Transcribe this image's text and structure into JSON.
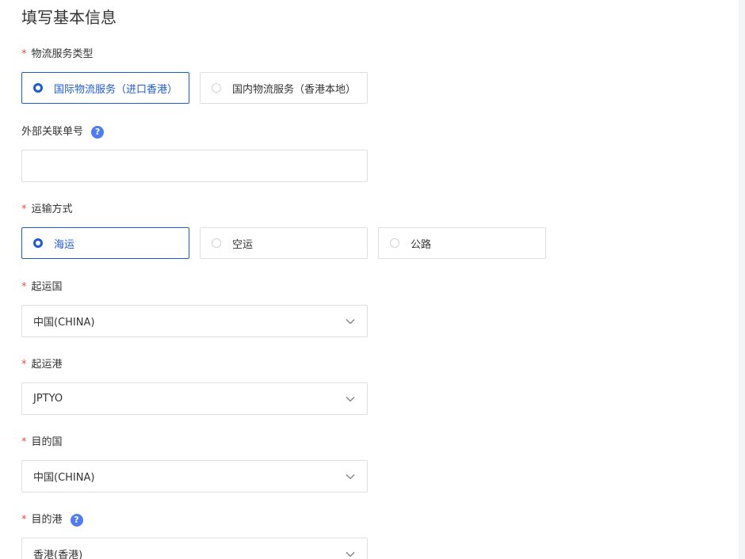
{
  "page": {
    "title": "填写基本信息"
  },
  "logistics_type": {
    "label": "物流服务类型",
    "required_mark": "*",
    "options": [
      {
        "label": "国际物流服务（进口香港）",
        "selected": true
      },
      {
        "label": "国内物流服务（香港本地）",
        "selected": false
      }
    ]
  },
  "external_order": {
    "label": "外部关联单号",
    "help_icon": "question-circle-icon",
    "help_glyph": "?",
    "value": ""
  },
  "transport_mode": {
    "label": "运输方式",
    "required_mark": "*",
    "options": [
      {
        "label": "海运",
        "selected": true
      },
      {
        "label": "空运",
        "selected": false
      },
      {
        "label": "公路",
        "selected": false
      }
    ]
  },
  "origin_country": {
    "label": "起运国",
    "required_mark": "*",
    "value": "中国(CHINA)"
  },
  "origin_port": {
    "label": "起运港",
    "required_mark": "*",
    "value": "JPTYO"
  },
  "dest_country": {
    "label": "目的国",
    "required_mark": "*",
    "value": "中国(CHINA)"
  },
  "dest_port": {
    "label": "目的港",
    "required_mark": "*",
    "help_icon": "question-circle-icon",
    "help_glyph": "?",
    "value": "香港(香港)"
  },
  "colors": {
    "accent": "#1e5bd8",
    "required": "#e8513b",
    "help": "#4d7cf4",
    "border": "#dcdfe6"
  }
}
